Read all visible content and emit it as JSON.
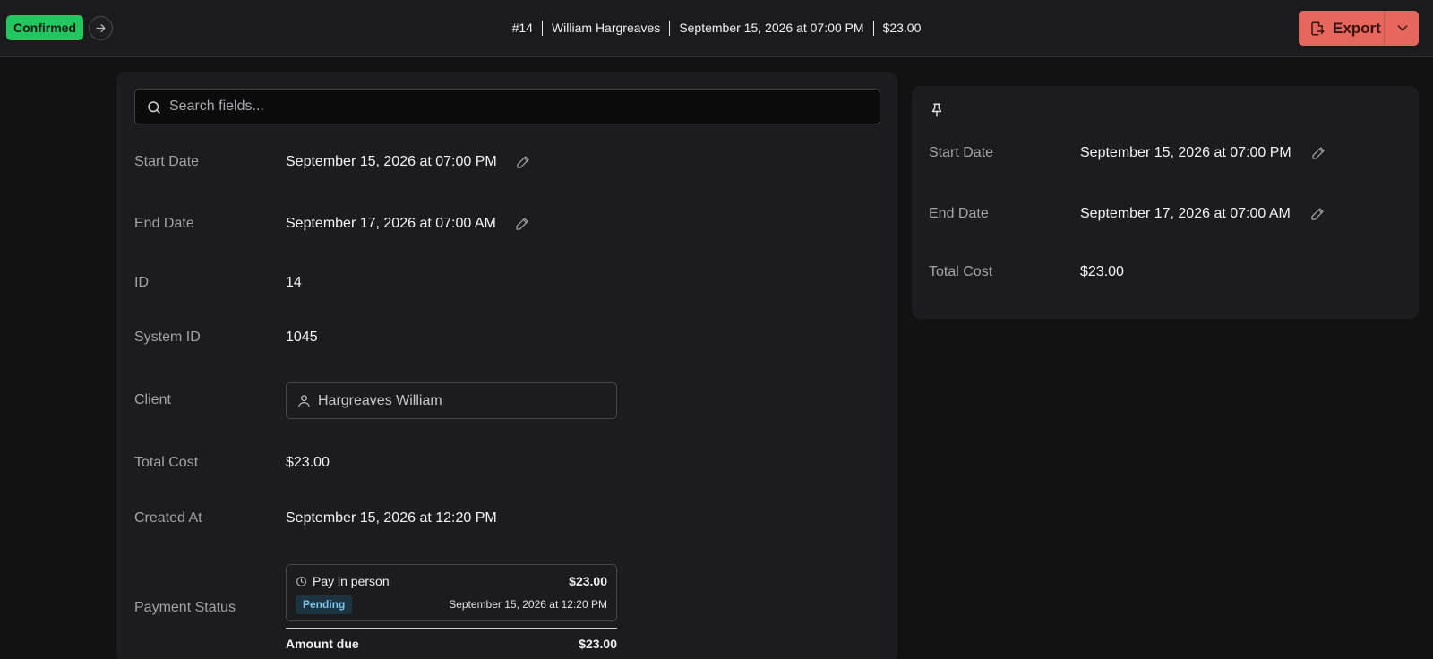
{
  "header": {
    "status": "Confirmed",
    "summary": {
      "id": "#14",
      "client": "William Hargreaves",
      "start": "September 15, 2026 at 07:00 PM",
      "total": "$23.00"
    },
    "export_label": "Export"
  },
  "search": {
    "placeholder": "Search fields..."
  },
  "fields": {
    "start_date": {
      "label": "Start Date",
      "value": "September 15, 2026 at 07:00 PM"
    },
    "end_date": {
      "label": "End Date",
      "value": "September 17, 2026 at 07:00 AM"
    },
    "id": {
      "label": "ID",
      "value": "14"
    },
    "system_id": {
      "label": "System ID",
      "value": "1045"
    },
    "client": {
      "label": "Client",
      "value": "Hargreaves William"
    },
    "total_cost": {
      "label": "Total Cost",
      "value": "$23.00"
    },
    "created_at": {
      "label": "Created At",
      "value": "September 15, 2026 at 12:20 PM"
    },
    "payment_status": {
      "label": "Payment Status",
      "method": "Pay in person",
      "amount": "$23.00",
      "state": "Pending",
      "date": "September 15, 2026 at 12:20 PM",
      "amount_due_label": "Amount due",
      "amount_due": "$23.00"
    }
  },
  "pinned": {
    "start_date": {
      "label": "Start Date",
      "value": "September 15, 2026 at 07:00 PM"
    },
    "end_date": {
      "label": "End Date",
      "value": "September 17, 2026 at 07:00 AM"
    },
    "total_cost": {
      "label": "Total Cost",
      "value": "$23.00"
    }
  },
  "colors": {
    "confirmed": "#22c55e",
    "export": "#e5675e",
    "pending_bg": "#1c3442",
    "pending_text": "#7cc4e8"
  },
  "icons": [
    "arrow-right-icon",
    "export-file-icon",
    "chevron-down-icon",
    "search-icon",
    "pencil-icon",
    "user-icon",
    "clock-icon",
    "pin-icon"
  ]
}
